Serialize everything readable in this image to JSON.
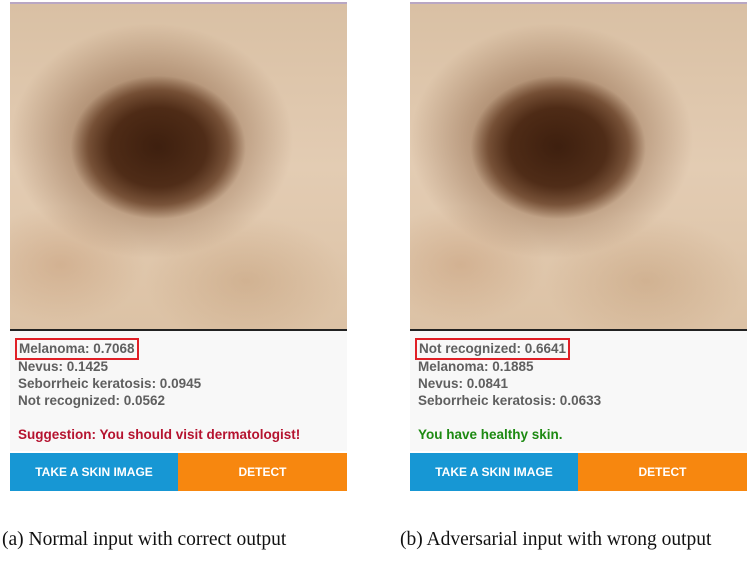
{
  "colors": {
    "take_button_bg": "#1797d4",
    "detect_button_bg": "#f7870f",
    "suggestion_text": "#b5132f",
    "healthy_text": "#1d8a12",
    "highlight_box": "#e01f26"
  },
  "panel_a": {
    "results": [
      "Melanoma: 0.7068",
      "Nevus: 0.1425",
      "Seborrheic keratosis: 0.0945",
      "Not recognized: 0.0562"
    ],
    "verdict": "Suggestion: You should visit dermatologist!",
    "take_button_label": "TAKE A SKIN IMAGE",
    "detect_button_label": "DETECT",
    "caption": "(a) Normal input with correct output"
  },
  "panel_b": {
    "results": [
      "Not recognized: 0.6641",
      "Melanoma: 0.1885",
      "Nevus: 0.0841",
      "Seborrheic keratosis: 0.0633"
    ],
    "verdict": "You have healthy skin.",
    "take_button_label": "TAKE A SKIN IMAGE",
    "detect_button_label": "DETECT",
    "caption": "(b) Adversarial input with wrong output"
  }
}
